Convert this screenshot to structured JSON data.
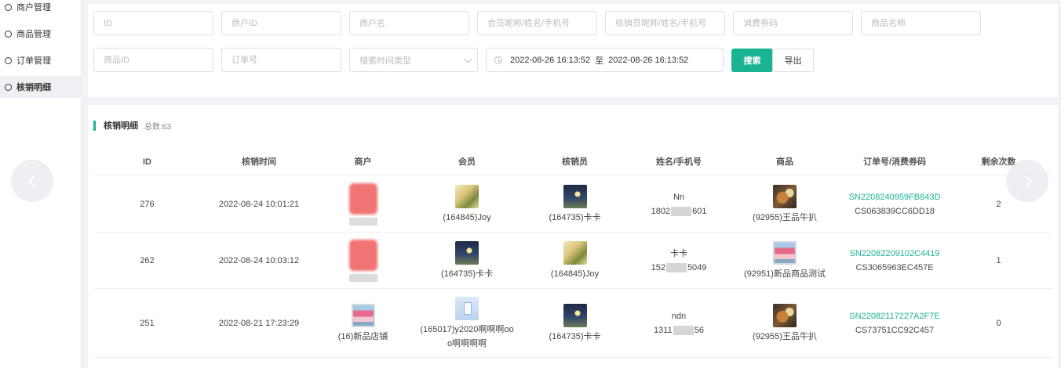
{
  "sidebar": {
    "items": [
      {
        "label": "商户管理"
      },
      {
        "label": "商品管理"
      },
      {
        "label": "订单管理"
      },
      {
        "label": "核销明细"
      }
    ]
  },
  "search": {
    "placeholders": {
      "id": "ID",
      "merchant_id": "商户ID",
      "merchant_name": "商户名",
      "member": "会员昵称/姓名/手机号",
      "verifier": "核销员昵称/姓名/手机号",
      "voucher": "消费券码",
      "product_name": "商品名称",
      "product_id": "商品ID",
      "order_no": "订单号",
      "time_type": "搜索时间类型"
    },
    "date_start": "2022-08-26 16:13:52",
    "date_sep": "至",
    "date_end": "2022-08-26 16:13:52",
    "search_button": "搜索",
    "export_button": "导出"
  },
  "table": {
    "title": "核销明细",
    "total": "总数:63",
    "headers": [
      "ID",
      "核销时间",
      "商户",
      "会员",
      "核销员",
      "姓名/手机号",
      "商品",
      "订单号/消费券码",
      "剩余次数"
    ],
    "rows": [
      {
        "id": "276",
        "time": "2022-08-24 10:01:21",
        "merchant": "",
        "member": "(164845)Joy",
        "verifier": "(164735)卡卡",
        "name": "Nn",
        "phone_prefix": "1802",
        "phone_suffix": "601",
        "product": "(92955)王品牛扒",
        "order_no": "SN2208240959FB843D",
        "voucher": "CS063839CC6DD18",
        "remaining": "2"
      },
      {
        "id": "262",
        "time": "2022-08-24 10:03:12",
        "merchant": "",
        "member": "(164735)卡卡",
        "verifier": "(164845)Joy",
        "name": "卡卡",
        "phone_prefix": "152",
        "phone_suffix": "5049",
        "product": "(92951)新品商品测试",
        "order_no": "SN22082209102C4419",
        "voucher": "CS3065963EC457E",
        "remaining": "1"
      },
      {
        "id": "251",
        "time": "2022-08-21 17:23:29",
        "merchant": "(16)新品店铺",
        "member_line1": "(165017)y2020啊啊啊oo",
        "member_line2": "o啊啊啊啊",
        "verifier": "(164735)卡卡",
        "name": "ndn",
        "phone_prefix": "1311",
        "phone_suffix": "56",
        "product": "(92955)王品牛扒",
        "order_no": "SN22082117227A2F7E",
        "voucher": "CS73751CC92C457",
        "remaining": "0"
      }
    ]
  },
  "icons": {
    "sidebar_item": "circle-icon",
    "date": "clock-icon",
    "prev": "chevron-left-icon",
    "next": "chevron-right-icon"
  },
  "colors": {
    "accent": "#1ab394",
    "background": "#f0f2f5"
  }
}
